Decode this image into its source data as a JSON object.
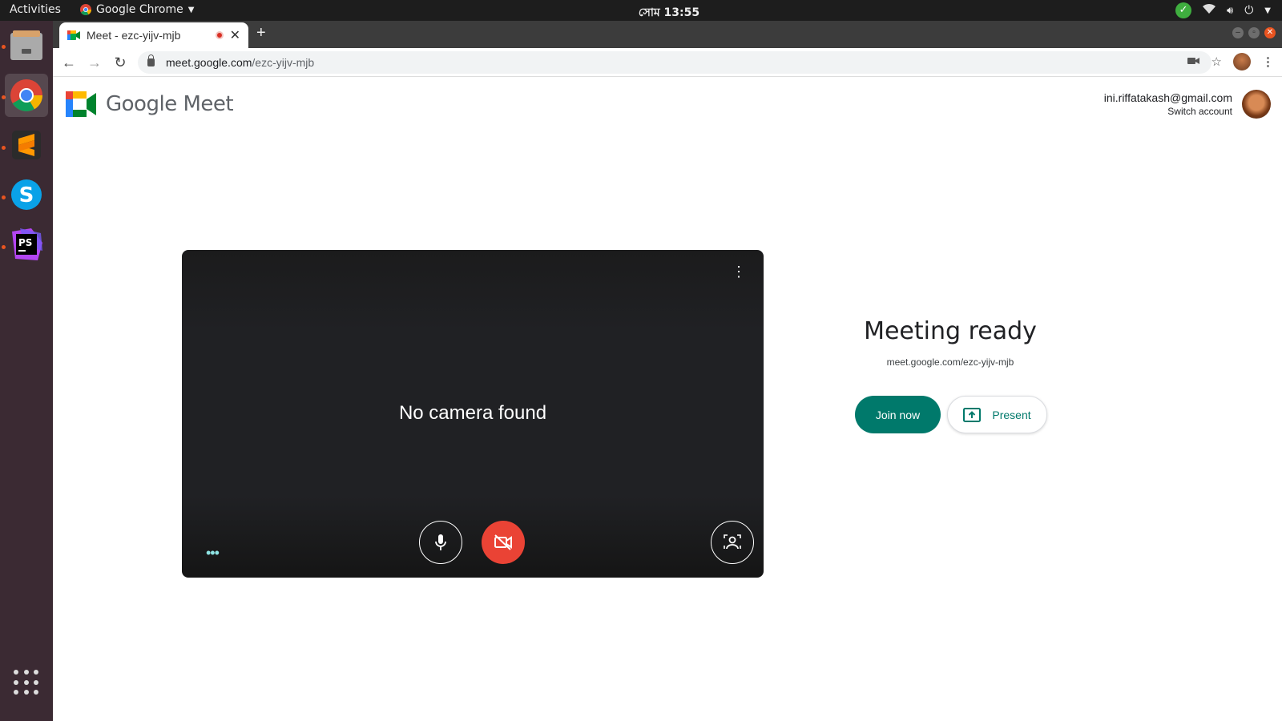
{
  "topbar": {
    "activities": "Activities",
    "app_name": "Google Chrome",
    "clock": "সোম 13:55"
  },
  "dock": {
    "apps": [
      "files",
      "google-chrome",
      "sublime-text",
      "skype",
      "phpstorm"
    ]
  },
  "browser": {
    "tab_title": "Meet - ezc-yijv-mjb",
    "url_host": "meet.google.com",
    "url_path": "/ezc-yijv-mjb"
  },
  "meet": {
    "brand": "Google Meet",
    "account_email": "ini.riffatakash@gmail.com",
    "switch_account": "Switch account",
    "no_camera": "No camera found",
    "ready_title": "Meeting ready",
    "meeting_link": "meet.google.com/ezc-yijv-mjb",
    "join_label": "Join now",
    "present_label": "Present"
  },
  "colors": {
    "join_green": "#00796b",
    "camera_off_red": "#ea4335",
    "preview_bg": "#202124"
  }
}
